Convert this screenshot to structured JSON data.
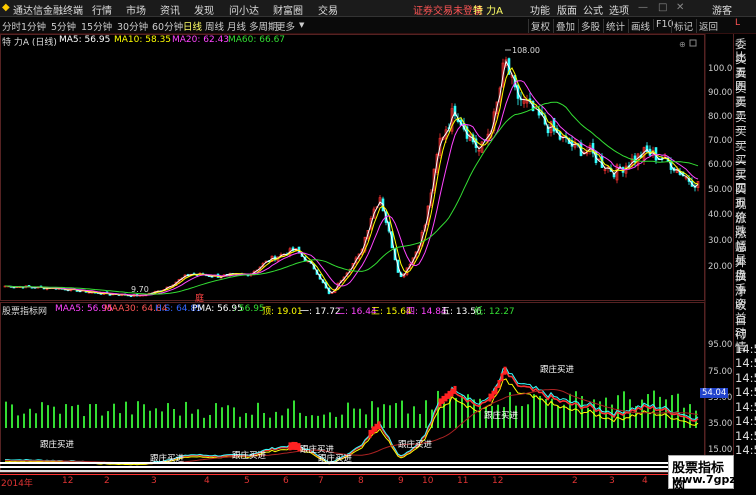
{
  "app": {
    "title": "通达信金融终端",
    "menu": [
      "行情",
      "市场",
      "资讯",
      "发现",
      "问小达",
      "财富圈",
      "交易"
    ],
    "notice": "证券交易未登录",
    "stock_name": "特 力A",
    "right_menu": [
      "功能",
      "版面",
      "公式",
      "选项"
    ],
    "user": "游客"
  },
  "toolbar": {
    "periods": [
      "分时",
      "1分钟",
      "5分钟",
      "15分钟",
      "30分钟",
      "60分钟",
      "日线",
      "周线",
      "月线",
      "多周期",
      "更多"
    ],
    "active": "日线",
    "right": [
      "复权",
      "叠加",
      "多股",
      "统计",
      "画线",
      "F10",
      "标记",
      "返回"
    ]
  },
  "main_chart": {
    "title": "特 力A (日线)",
    "ma": [
      {
        "label": "MA5: 56.95",
        "color": "#ffffff"
      },
      {
        "label": "MA10: 58.35",
        "color": "#ffff00"
      },
      {
        "label": "MA20: 62.43",
        "color": "#ff44ff"
      },
      {
        "label": "MA60: 66.67",
        "color": "#33dd33"
      }
    ],
    "high_label": "108.00",
    "low_label": "9.70",
    "y_ticks": [
      "100.0",
      "90.00",
      "80.00",
      "70.00",
      "60.00",
      "50.00",
      "40.00",
      "30.00",
      "20.00"
    ]
  },
  "indicator": {
    "title": "股票指标网",
    "fields": [
      {
        "label": "MAA5: 56.95",
        "color": "#ff44ff"
      },
      {
        "label": "MAA30: 64.84",
        "color": "#ff5555"
      },
      {
        "label": "H.S: 64.85",
        "color": "#3366ff"
      },
      {
        "label": "PMA: 56.95",
        "color": "#ffffff"
      },
      {
        "label": ": 56.95",
        "color": "#33dd33"
      },
      {
        "label": "顶: 19.01",
        "color": "#ffff00"
      },
      {
        "label": "一: 17.72",
        "color": "#ffffff"
      },
      {
        "label": "二: 16.44",
        "color": "#ff44ff"
      },
      {
        "label": "三: 15.64",
        "color": "#ffff00"
      },
      {
        "label": "四: 14.84",
        "color": "#ff44ff"
      },
      {
        "label": "五: 13.56",
        "color": "#ffffff"
      },
      {
        "label": "低: 12.27",
        "color": "#33dd33"
      }
    ],
    "y_ticks": [
      "95.00",
      "75.00",
      "55.00",
      "35.00",
      "15.00"
    ],
    "current_price": "54.04",
    "labels": [
      "跟庄买进",
      "跟庄买进",
      "跟庄买进",
      "跟庄买进",
      "跟庄买进",
      "跟庄买进",
      "跟庄买进",
      "跟庄买进"
    ],
    "marker": "庭"
  },
  "x_axis": [
    "2014年",
    "12",
    "2",
    "3",
    "4",
    "5",
    "6",
    "7",
    "8",
    "9",
    "10",
    "11",
    "12",
    "2",
    "3",
    "4"
  ],
  "right_panel": [
    "委比",
    "卖五",
    "卖四",
    "卖三",
    "卖二",
    "卖一",
    "买一",
    "买二",
    "买三",
    "买四",
    "买五",
    "现价",
    "涨跌",
    "涨幅",
    "总量",
    "外盘",
    "换手",
    "净资",
    "收益",
    "自动",
    "行情",
    "14:5",
    "14:5",
    "14:5",
    "14:5",
    "14:5",
    "14:5",
    "14:5",
    "14:5"
  ],
  "watermark": {
    "line1": "股票指标网",
    "line2": "www.7gpzb.com"
  },
  "colors": {
    "up": "#ff3333",
    "down": "#33ffff",
    "ma5": "#ffffff",
    "ma10": "#ffff00",
    "ma20": "#ff44ff",
    "ma60": "#33dd33"
  }
}
